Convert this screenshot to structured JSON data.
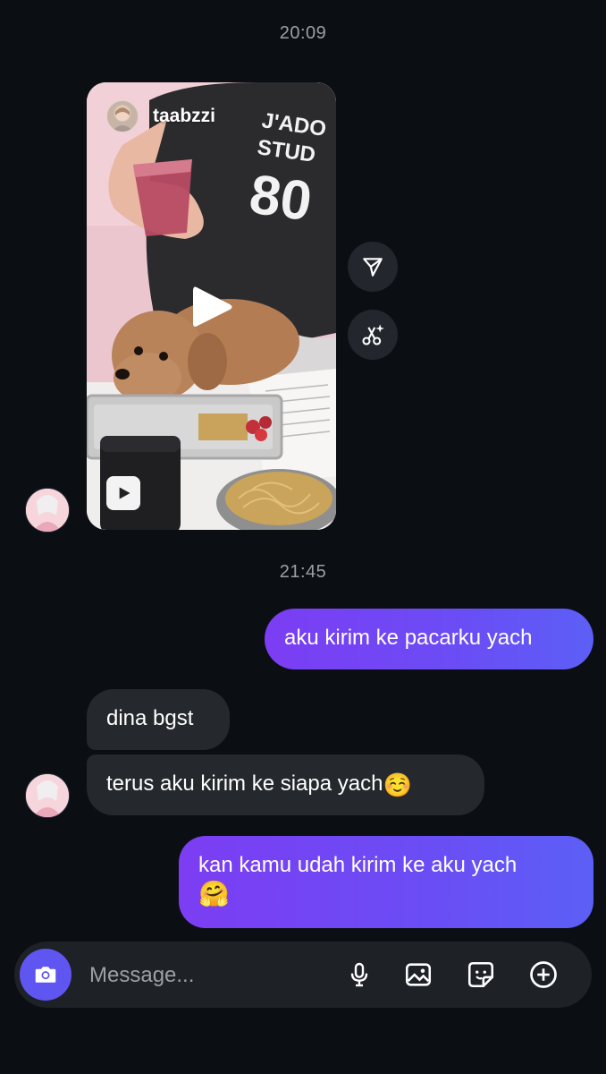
{
  "conversation": {
    "timestamps": [
      "20:09",
      "21:45"
    ],
    "shared_reel": {
      "author": "taabzzi",
      "shirt_text_line1": "J'ADO",
      "shirt_text_line2": "STUD",
      "shirt_text_line3": "80"
    },
    "messages": [
      {
        "direction": "outgoing",
        "text": "aku kirim ke pacarku yach"
      },
      {
        "direction": "incoming",
        "text": "dina bgst"
      },
      {
        "direction": "incoming",
        "text": "terus aku kirim ke siapa yach",
        "emoji": "☺️"
      },
      {
        "direction": "outgoing",
        "text": "kan kamu udah kirim ke aku yach",
        "emoji": "🤗"
      }
    ]
  },
  "composer": {
    "placeholder": "Message...",
    "icons": [
      "camera-icon",
      "microphone-icon",
      "gallery-icon",
      "sticker-icon",
      "add-icon"
    ]
  },
  "colors": {
    "background": "#0b0f14",
    "incoming_bubble": "#25282d",
    "outgoing_bubble_start": "#7c3df3",
    "outgoing_bubble_end": "#5c5ff6",
    "camera_button": "#5f55f0",
    "timestamp": "#9aa0a6"
  }
}
